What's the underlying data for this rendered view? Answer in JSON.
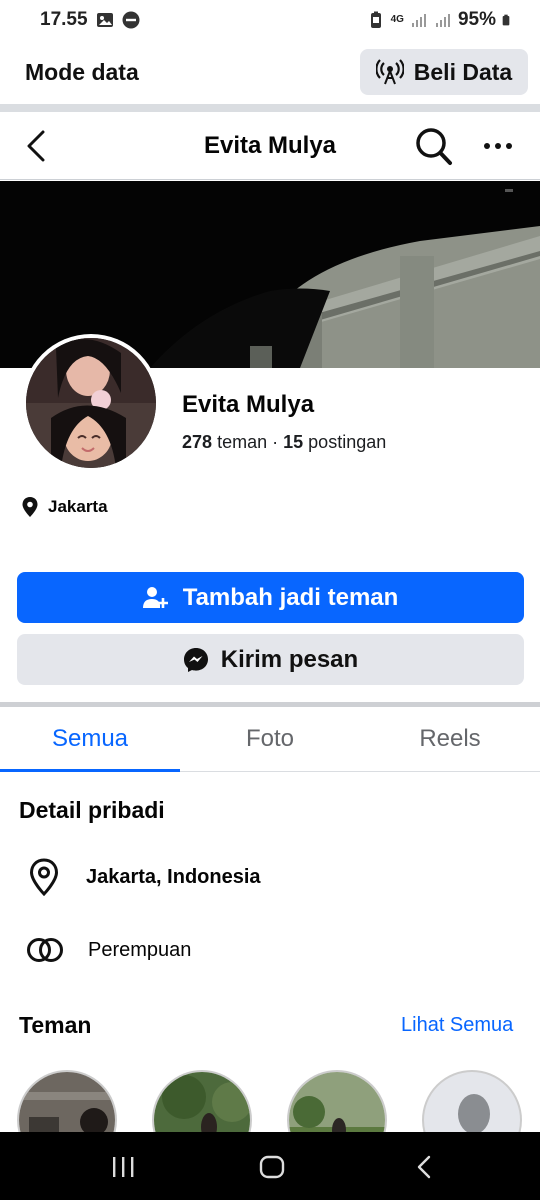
{
  "status": {
    "time": "17.55",
    "network": "4G",
    "battery": "95%"
  },
  "data_mode": {
    "title": "Mode data",
    "buy_label": "Beli Data"
  },
  "header": {
    "title": "Evita Mulya"
  },
  "profile": {
    "name": "Evita Mulya",
    "friends_count": "278",
    "friends_label": "teman",
    "separator": "·",
    "posts_count": "15",
    "posts_label": "postingan",
    "location": "Jakarta"
  },
  "actions": {
    "add_friend": "Tambah jadi teman",
    "message": "Kirim pesan"
  },
  "tabs": [
    {
      "label": "Semua",
      "active": true
    },
    {
      "label": "Foto",
      "active": false
    },
    {
      "label": "Reels",
      "active": false
    }
  ],
  "details": {
    "title": "Detail pribadi",
    "location": "Jakarta, Indonesia",
    "gender": "Perempuan"
  },
  "friends_section": {
    "title": "Teman",
    "see_all": "Lihat Semua"
  },
  "colors": {
    "accent": "#0866ff",
    "secondary_button": "#e4e6eb",
    "text": "#050505"
  },
  "icons": [
    "image-icon",
    "do-not-disturb-icon",
    "battery-saver-icon",
    "signal-icon",
    "battery-icon",
    "broadcast-icon",
    "back-icon",
    "search-icon",
    "more-icon",
    "location-pin-icon",
    "add-friend-icon",
    "messenger-icon",
    "gender-icon",
    "recents-icon",
    "home-icon",
    "android-back-icon"
  ]
}
